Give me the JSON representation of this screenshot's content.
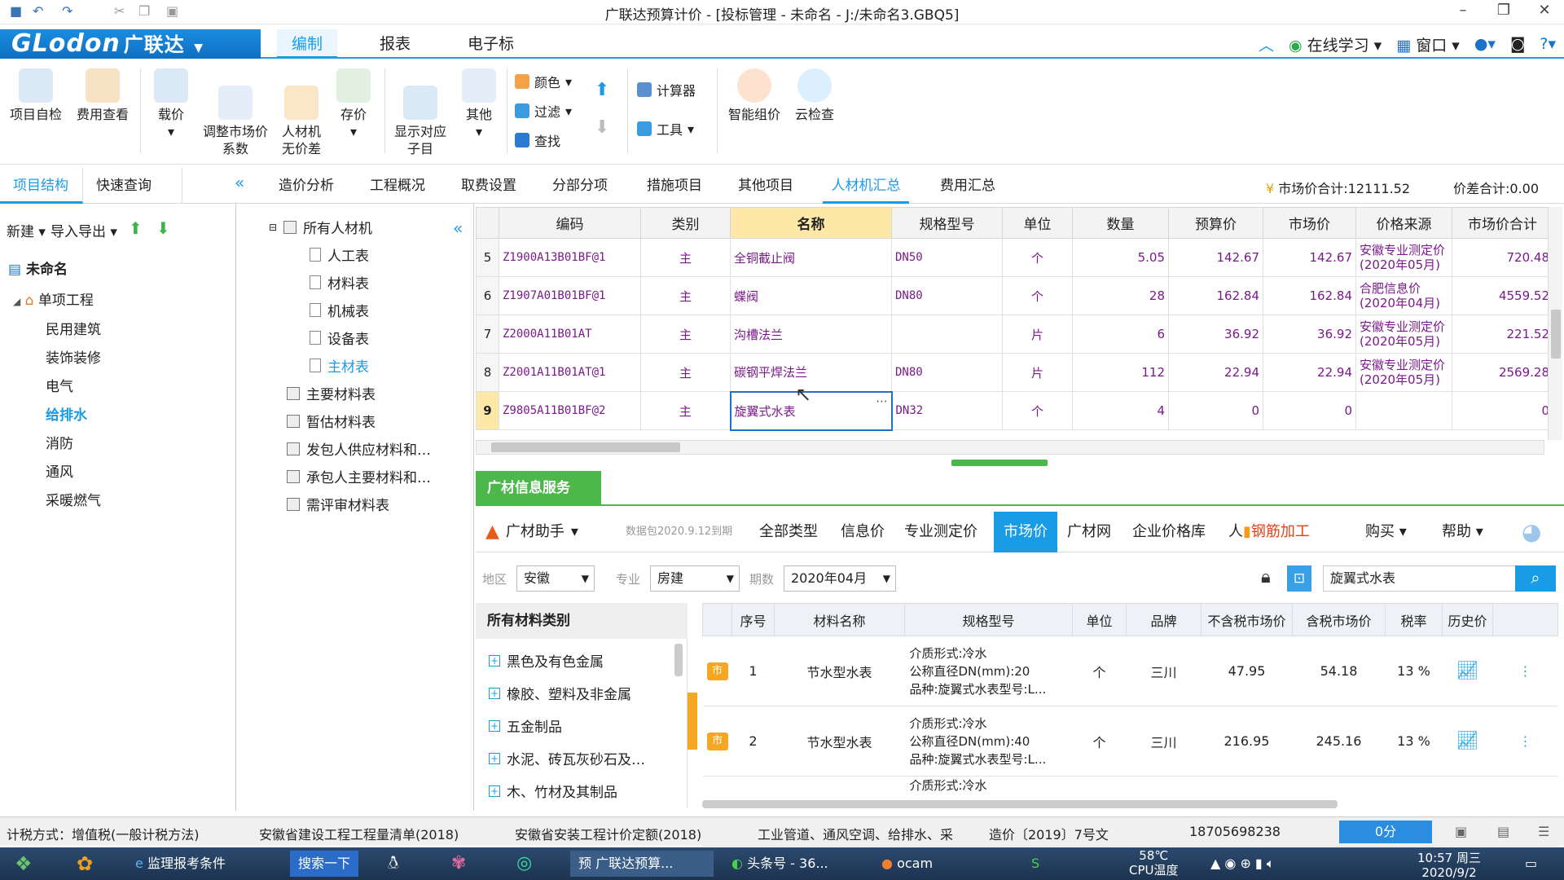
{
  "window": {
    "title": "广联达预算计价 - [投标管理 - 未命名 - J:/未命名3.GBQ5]"
  },
  "menubar": {
    "logo_brand": "GLodon",
    "logo_cn": "广联达",
    "tabs": [
      "编制",
      "报表",
      "电子标"
    ],
    "online_learning": "在线学习",
    "window_menu": "窗口"
  },
  "ribbon": {
    "buttons": [
      {
        "label": "项目自检",
        "icon": "project-check-icon"
      },
      {
        "label": "费用查看",
        "icon": "cost-view-icon"
      },
      {
        "label": "载价",
        "icon": "load-price-icon"
      },
      {
        "label": "调整市场价\n系数",
        "icon": "adjust-market-price-icon"
      },
      {
        "label": "人材机\n无价差",
        "icon": "scale-icon"
      },
      {
        "label": "存价",
        "icon": "save-price-icon"
      },
      {
        "label": "显示对应\n子目",
        "icon": "show-subitem-icon"
      },
      {
        "label": "其他",
        "icon": "grid-icon"
      },
      {
        "label": "智能组价",
        "icon": "smart-pricing-icon"
      },
      {
        "label": "云检查",
        "icon": "cloud-check-icon"
      }
    ],
    "color": "颜色",
    "filter": "过滤",
    "find": "查找",
    "calculator": "计算器",
    "tools": "工具"
  },
  "left_tabs": [
    "项目结构",
    "快速查询"
  ],
  "left_toolbar": {
    "new": "新建",
    "import_export": "导入导出"
  },
  "project_tree": {
    "root": "未命名",
    "unit": "单项工程",
    "items": [
      "民用建筑",
      "装饰装修",
      "电气",
      "给排水",
      "消防",
      "通风",
      "采暖燃气"
    ],
    "selected": "给排水"
  },
  "main_tabs": [
    "造价分析",
    "工程概况",
    "取费设置",
    "分部分项",
    "措施项目",
    "其他项目",
    "人材机汇总",
    "费用汇总"
  ],
  "summary": {
    "market_total": "市场价合计:12111.52",
    "diff_total": "价差合计:0.00"
  },
  "category_tree": {
    "root": "所有人材机",
    "children": [
      "人工表",
      "材料表",
      "机械表",
      "设备表",
      "主材表"
    ],
    "others": [
      "主要材料表",
      "暂估材料表",
      "发包人供应材料和…",
      "承包人主要材料和…",
      "需评审材料表"
    ],
    "selected": "主材表"
  },
  "grid": {
    "columns": [
      "编码",
      "类别",
      "名称",
      "规格型号",
      "单位",
      "数量",
      "预算价",
      "市场价",
      "价格来源",
      "市场价合计"
    ],
    "rows": [
      {
        "no": "5",
        "code": "Z1900A13B01BF@1",
        "type": "主",
        "name": "全铜截止阀",
        "spec": "DN50",
        "unit": "个",
        "qty": "5.05",
        "budget": "142.67",
        "market": "142.67",
        "src1": "安徽专业测定价",
        "src2": "(2020年05月)",
        "total": "720.48"
      },
      {
        "no": "6",
        "code": "Z1907A01B01BF@1",
        "type": "主",
        "name": "蝶阀",
        "spec": "DN80",
        "unit": "个",
        "qty": "28",
        "budget": "162.84",
        "market": "162.84",
        "src1": "合肥信息价",
        "src2": "(2020年04月)",
        "total": "4559.52"
      },
      {
        "no": "7",
        "code": "Z2000A11B01AT",
        "type": "主",
        "name": "沟槽法兰",
        "spec": "",
        "unit": "片",
        "qty": "6",
        "budget": "36.92",
        "market": "36.92",
        "src1": "安徽专业测定价",
        "src2": "(2020年05月)",
        "total": "221.52"
      },
      {
        "no": "8",
        "code": "Z2001A11B01AT@1",
        "type": "主",
        "name": "碳钢平焊法兰",
        "spec": "DN80",
        "unit": "片",
        "qty": "112",
        "budget": "22.94",
        "market": "22.94",
        "src1": "安徽专业测定价",
        "src2": "(2020年05月)",
        "total": "2569.28"
      },
      {
        "no": "9",
        "code": "Z9805A11B01BF@2",
        "type": "主",
        "name": "旋翼式水表",
        "spec": "DN32",
        "unit": "个",
        "qty": "4",
        "budget": "0",
        "market": "0",
        "src1": "",
        "src2": "",
        "total": "0"
      }
    ]
  },
  "info_service": {
    "title": "广材信息服务",
    "assistant": "广材助手",
    "data_note": "数据包2020.9.12到期",
    "tabs": [
      "全部类型",
      "信息价",
      "专业测定价",
      "市场价",
      "广材网",
      "企业价格库",
      "人",
      "钢筋加工",
      "购买",
      "帮助"
    ],
    "active_tab": "市场价",
    "filters": {
      "region_label": "地区",
      "region": "安徽",
      "major_label": "专业",
      "major": "房建",
      "period_label": "期数",
      "period": "2020年04月"
    },
    "search_value": "旋翼式水表",
    "category_header": "所有材料类别",
    "categories": [
      "黑色及有色金属",
      "橡胶、塑料及非金属",
      "五金制品",
      "水泥、砖瓦灰砂石及…",
      "木、竹材及其制品"
    ],
    "columns": [
      "序号",
      "材料名称",
      "规格型号",
      "单位",
      "品牌",
      "不含税市场价",
      "含税市场价",
      "税率",
      "历史价"
    ],
    "rows": [
      {
        "badge": "市",
        "no": "1",
        "name": "节水型水表",
        "spec1": "介质形式:冷水",
        "spec2": "公称直径DN(mm):20",
        "spec3": "品种:旋翼式水表型号:L...",
        "unit": "个",
        "brand": "三川",
        "price_ex": "47.95",
        "price_in": "54.18",
        "tax": "13 %"
      },
      {
        "badge": "市",
        "no": "2",
        "name": "节水型水表",
        "spec1": "介质形式:冷水",
        "spec2": "公称直径DN(mm):40",
        "spec3": "品种:旋翼式水表型号:L...",
        "unit": "个",
        "brand": "三川",
        "price_ex": "216.95",
        "price_in": "245.16",
        "tax": "13 %"
      },
      {
        "badge": "",
        "no": "",
        "name": "",
        "spec1": "介质形式:冷水",
        "spec2": "",
        "spec3": "",
        "unit": "",
        "brand": "",
        "price_ex": "",
        "price_in": "",
        "tax": ""
      }
    ]
  },
  "statusbar": {
    "tax_method": "计税方式：增值税(一般计税方法)",
    "list_std": "安徽省建设工程工程量清单(2018)",
    "quota": "安徽省安装工程计价定额(2018)",
    "scope": "工业管道、通风空调、给排水、采",
    "doc": "造价〔2019〕7号文",
    "phone": "18705698238",
    "score": "0分"
  },
  "taskbar": {
    "items": [
      "监理报考条件",
      "搜索一下",
      "广联达预算...",
      "头条号 - 36...",
      "ocam"
    ],
    "temp": "58℃",
    "temp_label": "CPU温度",
    "time": "10:57 周三",
    "date": "2020/9/2"
  }
}
